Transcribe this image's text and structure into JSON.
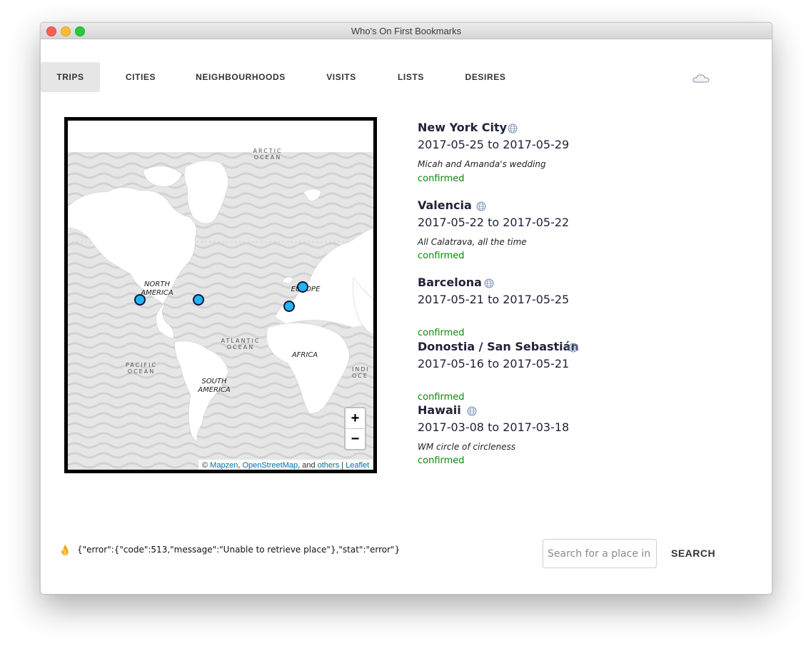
{
  "window": {
    "title": "Who's On First Bookmarks"
  },
  "nav": {
    "tabs": [
      {
        "label": "TRIPS",
        "active": true
      },
      {
        "label": "CITIES",
        "active": false
      },
      {
        "label": "NEIGHBOURHOODS",
        "active": false
      },
      {
        "label": "VISITS",
        "active": false
      },
      {
        "label": "LISTS",
        "active": false
      },
      {
        "label": "DESIRES",
        "active": false
      }
    ],
    "status_icon": "cloud-icon"
  },
  "map": {
    "labels": {
      "arctic_ocean": "ARCTIC OCEAN",
      "north_america": "NORTH AMERICA",
      "europe": "EUROPE",
      "atlantic_ocean": "ATLANTIC OCEAN",
      "africa": "AFRICA",
      "pacific_ocean": "PACIFIC OCEAN",
      "south_america": "SOUTH AMERICA",
      "indian_ocean_partial": "INDI OCE"
    },
    "zoom_in": "+",
    "zoom_out": "−",
    "attribution": {
      "prefix": "© ",
      "mapzen": "Mapzen",
      "sep1": ", ",
      "osm": "OpenStreetMap",
      "sep2": ", and ",
      "others": "others",
      "sep3": " | ",
      "leaflet": "Leaflet"
    },
    "marker_color": "#26b3f2"
  },
  "trips": [
    {
      "name": "New York City",
      "dates": "2017-05-25 to 2017-05-29",
      "note": "Micah and Amanda's wedding",
      "status": "confirmed"
    },
    {
      "name": "Valencia",
      "dates": "2017-05-22 to 2017-05-22",
      "note": "All Calatrava, all the time",
      "status": "confirmed"
    },
    {
      "name": "Barcelona",
      "dates": "2017-05-21 to 2017-05-25",
      "note": "",
      "status": "confirmed"
    },
    {
      "name": "Donostia / San Sebastián",
      "dates": "2017-05-16 to 2017-05-21",
      "note": "",
      "status": "confirmed"
    },
    {
      "name": "Hawaii",
      "dates": "2017-03-08 to 2017-03-18",
      "note": "WM circle of circleness",
      "status": "confirmed"
    }
  ],
  "footer": {
    "error_icon": "fire-icon",
    "error_text": "{\"error\":{\"code\":513,\"message\":\"Unable to retrieve place\"},\"stat\":\"error\"}",
    "search_placeholder": "Search for a place in W",
    "search_button": "SEARCH"
  },
  "colors": {
    "status_confirmed": "#0a8a0a",
    "title_text": "#22223a",
    "active_tab_bg": "#e6e6e6"
  }
}
